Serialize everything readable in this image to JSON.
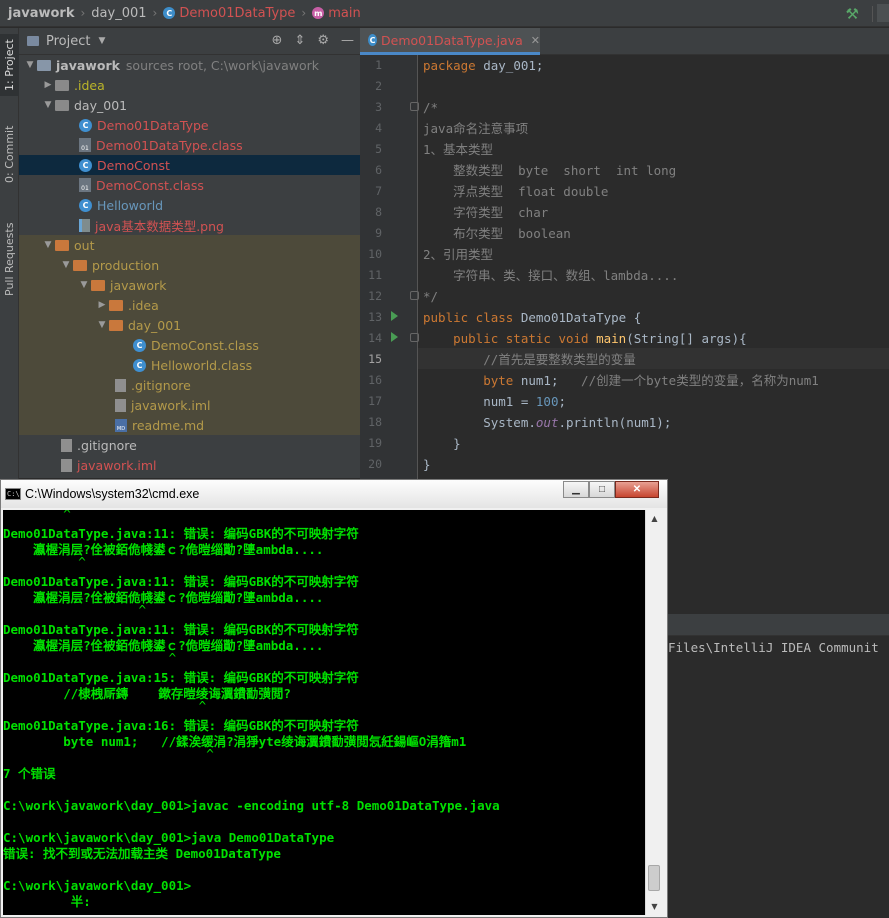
{
  "navbar": {
    "project": "javawork",
    "folder": "day_001",
    "class_name": "Demo01DataType",
    "method": "main"
  },
  "toolstrip": {
    "project_tab": "1: Project",
    "commit_tab": "0: Commit",
    "pull_tab": "Pull Requests"
  },
  "project_panel": {
    "title": "Project",
    "root_name": "javawork",
    "root_hint": "sources root,  C:\\work\\javawork",
    "items": {
      "idea": ".idea",
      "day_001": "day_001",
      "f1": "Demo01DataType",
      "f2": "Demo01DataType.class",
      "f3": "DemoConst",
      "f4": "DemoConst.class",
      "f5": "Helloworld",
      "f6": "java基本数据类型.png",
      "out": "out",
      "production": "production",
      "javawork2": "javawork",
      "idea2": ".idea",
      "day_001b": "day_001",
      "g1": "DemoConst.class",
      "g2": "Helloworld.class",
      "gitignore": ".gitignore",
      "iml": "javawork.iml",
      "readme": "readme.md",
      "gitignore2": ".gitignore",
      "iml2": "javawork.iml"
    }
  },
  "editor": {
    "tab_label": "Demo01DataType.java",
    "line_numbers": [
      "1",
      "2",
      "3",
      "4",
      "5",
      "6",
      "7",
      "8",
      "9",
      "10",
      "11",
      "12",
      "13",
      "14",
      "15",
      "16",
      "17",
      "18",
      "19",
      "20"
    ],
    "code": {
      "l1_kw": "package",
      "l1_rest": " day_001;",
      "l3": "/*",
      "l4": "java命名注意事项",
      "l5": "1、基本类型",
      "l6": "    整数类型  byte  short  int long",
      "l7": "    浮点类型  float double",
      "l8": "    字符类型  char",
      "l9": "    布尔类型  boolean",
      "l10": "2、引用类型",
      "l11": "    字符串、类、接口、数组、lambda....",
      "l12": "*/",
      "l13_kw": "public class",
      "l13_rest": " Demo01DataType {",
      "l14_kw": "    public static void",
      "l14_fn": " main",
      "l14_rest": "(String[] args){",
      "l15": "        //首先是要整数类型的变量",
      "l16_kw": "        byte",
      "l16_rest": " num1;   ",
      "l16_cm": "//创建一个byte类型的变量，名称为num1",
      "l17_a": "        num1 = ",
      "l17_num": "100",
      "l17_b": ";",
      "l18_a": "        System.",
      "l18_fld": "out",
      "l18_b": ".println(num1);",
      "l19": "    }",
      "l20": "}"
    }
  },
  "run_panel": {
    "text": "Files\\IntelliJ IDEA Communit"
  },
  "cmd": {
    "title": "C:\\Windows\\system32\\cmd.exe",
    "lines": {
      "c0": "        ^",
      "c1": "Demo01DataType.java:11: 错误: 编码GBK的不可映射字符",
      "c2": "    瀛楃涓层?佺被銆佹帴鍙ｃ?佹暟缁勩?塦ambda....",
      "c3": "          ^",
      "c4": "Demo01DataType.java:11: 错误: 编码GBK的不可映射字符",
      "c5": "    瀛楃涓层?佺被銆佹帴鍙ｃ?佹暟缁勩?塦ambda....",
      "c6": "                  ^",
      "c7": "Demo01DataType.java:11: 错误: 编码GBK的不可映射字符",
      "c8": "    瀛楃涓层?佺被銆佹帴鍙ｃ?佹暟缁勩?塦ambda....",
      "c9": "                      ^",
      "c10": "Demo01DataType.java:15: 错误: 编码GBK的不可映射字符",
      "c11": "        //棣栧厛鏄    鏉存暟绫诲瀷鐨勫彉閲?",
      "c12": "                          ^",
      "c13": "Demo01DataType.java:16: 错误: 编码GBK的不可映射字符",
      "c14": "        byte num1;   //鍒涘缓涓?涓猙yte绫诲瀷鐨勫彉閲忥紝鍚嶇О涓簎m1",
      "c15": "                           ^",
      "c16": "7 个错误",
      "c17": "C:\\work\\javawork\\day_001>javac -encoding utf-8 Demo01DataType.java",
      "c18": "C:\\work\\javawork\\day_001>java Demo01DataType",
      "c19": "错误: 找不到或无法加载主类 Demo01DataType",
      "c20": "C:\\work\\javawork\\day_001>",
      "c21": "         半:"
    }
  }
}
